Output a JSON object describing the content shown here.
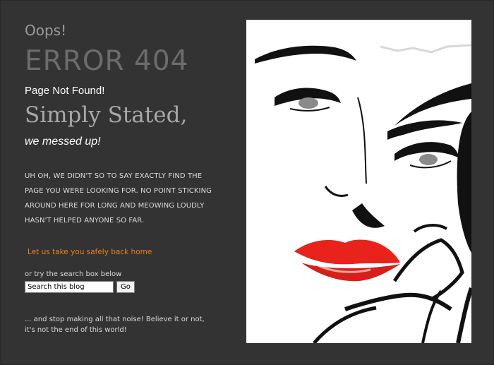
{
  "header": {
    "oops": "Oops!",
    "error_code": "ERROR 404",
    "not_found": "Page Not Found!",
    "simply_stated": "Simply Stated,",
    "messed_up": "we messed up!"
  },
  "message": "UH OH, WE DIDN'T SO TO SAY EXACTLY FIND THE PAGE YOU WERE LOOKING FOR.  NO POINT STICKING AROUND HERE FOR LONG AND MEOWING LOUDLY HASN'T HELPED ANYONE SO FAR.",
  "home_link": "Let us take you safely back home",
  "search": {
    "prompt": "or try the search box below",
    "value": "Search this blog",
    "button": "Go"
  },
  "closing": "... and stop making all that noise! Believe it or not, it's not the end of this world!",
  "colors": {
    "background": "#333333",
    "link": "#e8821a",
    "lips": "#e8231c"
  },
  "icons": {
    "illustration": "woman-face-illustration"
  }
}
